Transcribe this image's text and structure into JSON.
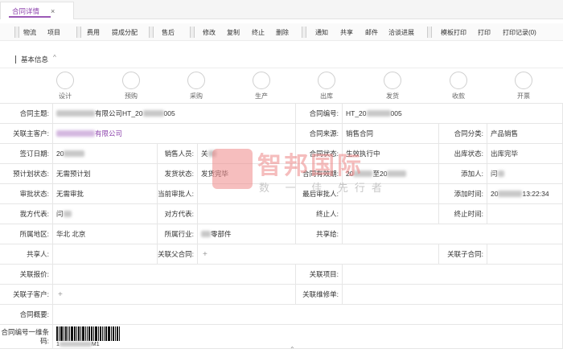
{
  "tab": {
    "title": "合同详情",
    "close": "×"
  },
  "toolbar": {
    "buttons": [
      "物流",
      "项目",
      "费用",
      "提成分配",
      "售后",
      "修改",
      "复制",
      "终止",
      "删除",
      "通知",
      "共享",
      "邮件",
      "洽谈进展",
      "模板打印",
      "打印",
      "打印记录(0)"
    ]
  },
  "section": {
    "title": "基本信息",
    "chevron": "^"
  },
  "steps": [
    "设计",
    "预购",
    "采购",
    "生产",
    "出库",
    "发货",
    "收款",
    "开票"
  ],
  "fields": {
    "l_main": "合同主题:",
    "v_main_suffix": "有限公司HT_20",
    "v_main_end": "005",
    "l_no": "合同编号:",
    "v_no": "HT_20",
    "v_no_end": "005",
    "l_cust": "关联主客户:",
    "v_cust": "有限公司",
    "l_src": "合同来源:",
    "v_src": "销售合同",
    "l_cat": "合同分类:",
    "v_cat": "产品销售",
    "l_sign": "签订日期:",
    "v_sign": "20",
    "l_sales": "销售人员:",
    "v_sales": "关",
    "l_status": "合同状态:",
    "v_status": "生效执行中",
    "l_out": "出库状态:",
    "v_out": "出库完毕",
    "l_plan": "预计划状态:",
    "v_plan": "无需预计划",
    "l_ship": "发货状态:",
    "v_ship": "发货完毕",
    "l_valid": "合同有效期:",
    "v_valid_a": "20",
    "v_valid_b": "至20",
    "l_adder": "添加人:",
    "v_adder": "闫",
    "l_appr": "审批状态:",
    "v_appr": "无需审批",
    "l_cur": "当前审批人:",
    "v_cur": "",
    "l_last": "最后审批人:",
    "v_last": "",
    "l_time": "添加时间:",
    "v_time_a": "20",
    "v_time_b": "13:22:34",
    "l_our": "我方代表:",
    "v_our": "闫",
    "l_their": "对方代表:",
    "v_their": "",
    "l_term": "终止人:",
    "v_term": "",
    "l_termt": "终止时间:",
    "v_termt": "",
    "l_region": "所属地区:",
    "v_region": "华北 北京",
    "l_ind": "所属行业:",
    "v_ind": "零部件",
    "l_share": "共享给:",
    "v_share": "",
    "l_sharer": "共享人:",
    "v_sharer": "",
    "l_parent": "关联父合同:",
    "v_parent": "+",
    "l_child": "关联子合同:",
    "v_child": "",
    "l_quote": "关联报价:",
    "v_quote": "",
    "l_proj": "关联项目:",
    "v_proj": "",
    "l_sub": "关联子客户:",
    "v_sub": "+",
    "l_repair": "关联维修单:",
    "v_repair": "",
    "l_summary": "合同概要:",
    "v_summary": "",
    "l_bar": "合同编号一维条码:",
    "v_bar_a": "1",
    "v_bar_b": "M1"
  },
  "watermark": {
    "big": "智邦国际",
    "small": "数 一 佳 先行者"
  },
  "scroll": "⌃",
  "colors": {
    "accent": "#8e44ad"
  }
}
